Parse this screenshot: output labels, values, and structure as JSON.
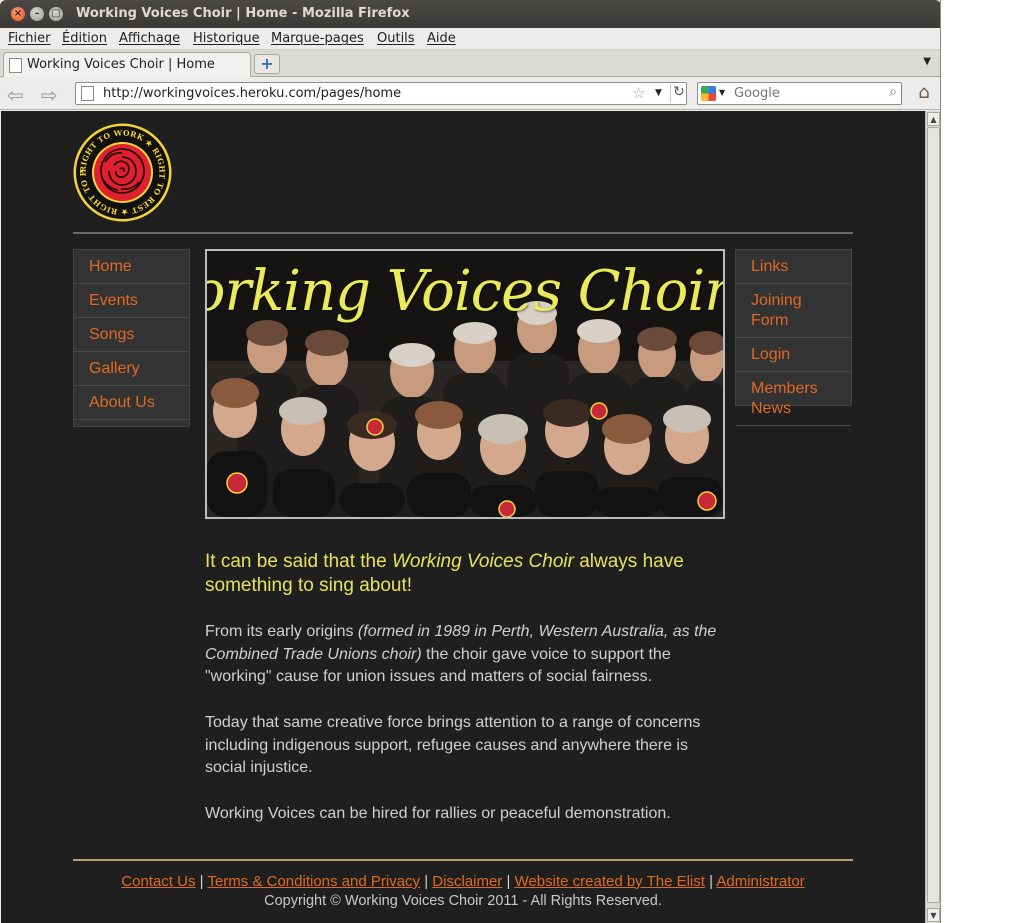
{
  "window": {
    "title": "Working Voices Choir | Home - Mozilla Firefox"
  },
  "menubar": {
    "items": [
      "Fichier",
      "Édition",
      "Affichage",
      "Historique",
      "Marque-pages",
      "Outils",
      "Aide"
    ]
  },
  "tabs": [
    {
      "label": "Working Voices Choir | Home"
    }
  ],
  "navigation": {
    "url": "http://workingvoices.heroku.com/pages/home",
    "search_placeholder": "Google"
  },
  "page": {
    "logo": {
      "ring_text": "RIGHT TO WORK ★ RIGHT TO REST ★ RIGHT TO PLAY ★ RIGHTS FOR ALL ★"
    },
    "nav_left": [
      "Home",
      "Events",
      "Songs",
      "Gallery",
      "About Us"
    ],
    "nav_right": [
      "Links",
      "Joining Form",
      "Login",
      "Members News"
    ],
    "hero_title": "Working Voices Choir",
    "intro": {
      "before": "It can be said that the ",
      "emphasis": "Working Voices Choir",
      "after": " always have something to sing about!"
    },
    "para1": {
      "before": "From its early origins ",
      "emphasis": "(formed in 1989 in Perth, Western Australia, as the Combined Trade Unions choir)",
      "after": " the choir gave voice to support the \"working\" cause for union issues and matters of social fairness."
    },
    "para2": "Today that same creative force brings attention to a range of concerns including indigenous support, refugee causes and anywhere there is social injustice.",
    "para3": "Working Voices can be hired for rallies or peaceful demonstration.",
    "footer": {
      "links": [
        "Contact Us",
        "Terms & Conditions and Privacy",
        "Disclaimer",
        "Website created by The Elist",
        "Administrator"
      ],
      "separator": "|",
      "copyright": "Copyright © Working Voices Choir 2011 - All Rights Reserved."
    }
  },
  "colors": {
    "page_background": "#1f1f1f",
    "link_orange": "#e06a25",
    "intro_yellow": "#e6e25e",
    "hero_title_yellow": "#eaea5a",
    "logo_rose_red": "#e02030",
    "logo_ring_yellow": "#f3d43a"
  }
}
